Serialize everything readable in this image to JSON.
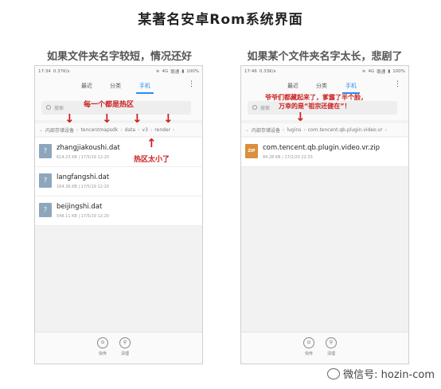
{
  "title": "某著名安卓Rom系统界面",
  "left": {
    "subtitle": "如果文件夹名字较短，情况还好",
    "status": {
      "time": "17:34",
      "speed": "0.37K/s",
      "network": "4G",
      "carrier": "联通",
      "battery": "100%"
    },
    "tabs": [
      "最近",
      "分类",
      "手机"
    ],
    "search_placeholder": "搜索",
    "breadcrumb": [
      "内部存储设备",
      "tencentmapsdk",
      "data",
      "v3",
      "render"
    ],
    "files": [
      {
        "name": "zhangjiakoushi.dat",
        "meta": "614.23 KB | 17/5/19 12:20"
      },
      {
        "name": "langfangshi.dat",
        "meta": "164.36 KB | 17/5/19 12:20"
      },
      {
        "name": "beijingshi.dat",
        "meta": "548.11 KB | 17/5/19 12:20"
      }
    ],
    "bottom": [
      "快传",
      "清理"
    ],
    "annotation_top": "每一个都是热区",
    "annotation_bottom": "热区太小了"
  },
  "right": {
    "subtitle": "如果某个文件夹名字太长，悲剧了",
    "status": {
      "time": "17:46",
      "speed": "0.33K/s",
      "network": "4G",
      "carrier": "联通",
      "battery": "100%"
    },
    "tabs": [
      "最近",
      "分类",
      "手机"
    ],
    "search_placeholder": "搜索",
    "breadcrumb": [
      "内部存储设备",
      "lugins",
      "com.tencent.qb.plugin.video.vr"
    ],
    "files": [
      {
        "name": "com.tencent.qb.plugin.video.vr.zip",
        "meta": "84.28 KB | 17/2/20 22:33",
        "badge": "ZIP"
      }
    ],
    "bottom": [
      "快传",
      "清理"
    ],
    "annotation_line1": "爷爷们都藏起来了，爹露了半个脸，",
    "annotation_line2": "万幸的是“祖宗还健在”！"
  },
  "watermark": "微信号: hozin-com"
}
